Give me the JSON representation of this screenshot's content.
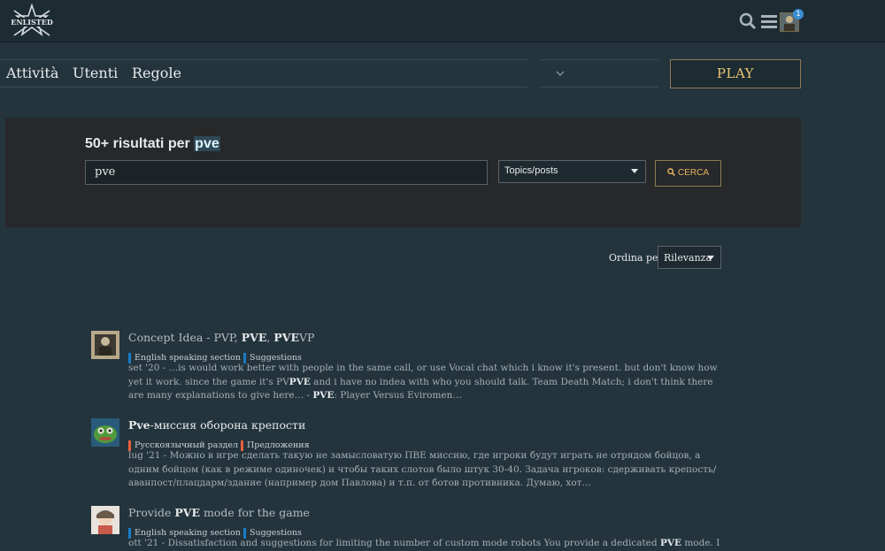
{
  "header": {
    "logo_text": "ENLISTED",
    "notification_count": "1"
  },
  "nav": {
    "items": [
      "Attività",
      "Utenti",
      "Regole"
    ],
    "play_label": "PLAY"
  },
  "search": {
    "title_prefix": "50+ risultati per",
    "query": "pve",
    "input_value": "pve",
    "scope": "Topics/posts",
    "button_label": "CERCA"
  },
  "sort": {
    "label": "Ordina per",
    "value": "Rilevanza"
  },
  "results": [
    {
      "title_parts": [
        "Concept Idea - PVP, ",
        "PVE",
        ", ",
        "PVE",
        "VP"
      ],
      "tags": [
        {
          "label": "English speaking section",
          "color": "#1a7bc4"
        },
        {
          "label": "Suggestions",
          "color": "#1a7bc4"
        }
      ],
      "blurb_parts": [
        "set '20 - …is would work better with people in the same call, or use Vocal chat which i know it's present. but don't know how yet it work. since the game it's PV",
        "PVE",
        " and i have no indea with who you should talk. Team Death Match; i don't think there are many explanations to give here… - ",
        "PVE",
        ": Player Versus Eviromen…"
      ]
    },
    {
      "title_parts": [
        "Pve",
        "-миссия оборона крепости"
      ],
      "tags": [
        {
          "label": "Русскоязычный раздел",
          "color": "#e8603c"
        },
        {
          "label": "Предложения",
          "color": "#e8603c"
        }
      ],
      "blurb_parts": [
        "lug '21 - Можно в игре сделать такую не замысловатую ПВЕ миссию, где игроки будут играть не отрядом бойцов, а одним бойцом (как в режиме одиночек) и чтобы таких слотов было штук 30-40. Задача игроков: сдерживать крепость/аванпост/плацдарм/здание (например дом Павлова) и т.п. от ботов противника. Думаю, хот…"
      ]
    },
    {
      "title_parts": [
        "Provide ",
        "PVE",
        " mode for the game"
      ],
      "tags": [
        {
          "label": "English speaking section",
          "color": "#1a7bc4"
        },
        {
          "label": "Suggestions",
          "color": "#1a7bc4"
        }
      ],
      "blurb_parts": [
        "ott '21 - Dissatisfaction and suggestions for limiting the number of custom mode robots You provide a dedicated ",
        "PVE",
        " mode. I don't want to"
      ]
    }
  ]
}
